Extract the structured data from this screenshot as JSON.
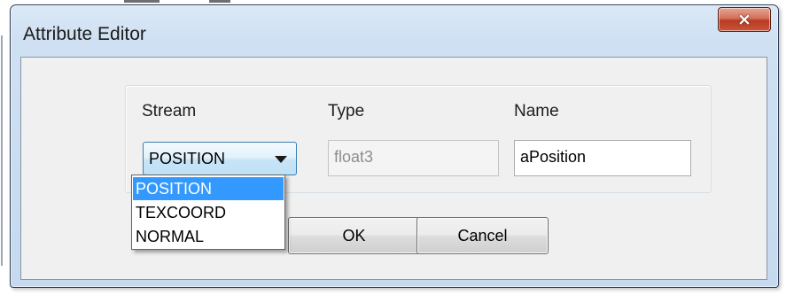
{
  "window": {
    "title": "Attribute Editor",
    "close_glyph": "×"
  },
  "labels": {
    "stream": "Stream",
    "type": "Type",
    "name": "Name"
  },
  "stream_combo": {
    "selected": "POSITION",
    "options": [
      "POSITION",
      "TEXCOORD",
      "NORMAL"
    ],
    "highlighted_index": 0,
    "open": true
  },
  "type_field": {
    "value": "float3",
    "enabled": false
  },
  "name_field": {
    "value": "aPosition"
  },
  "buttons": {
    "ok": "OK",
    "cancel": "Cancel"
  },
  "icons": {
    "close": "close-icon",
    "dropdown": "chevron-down-icon"
  },
  "colors": {
    "selection": "#3399ff",
    "close_button": "#c9553a",
    "title_bar": "#cfe0f2"
  }
}
